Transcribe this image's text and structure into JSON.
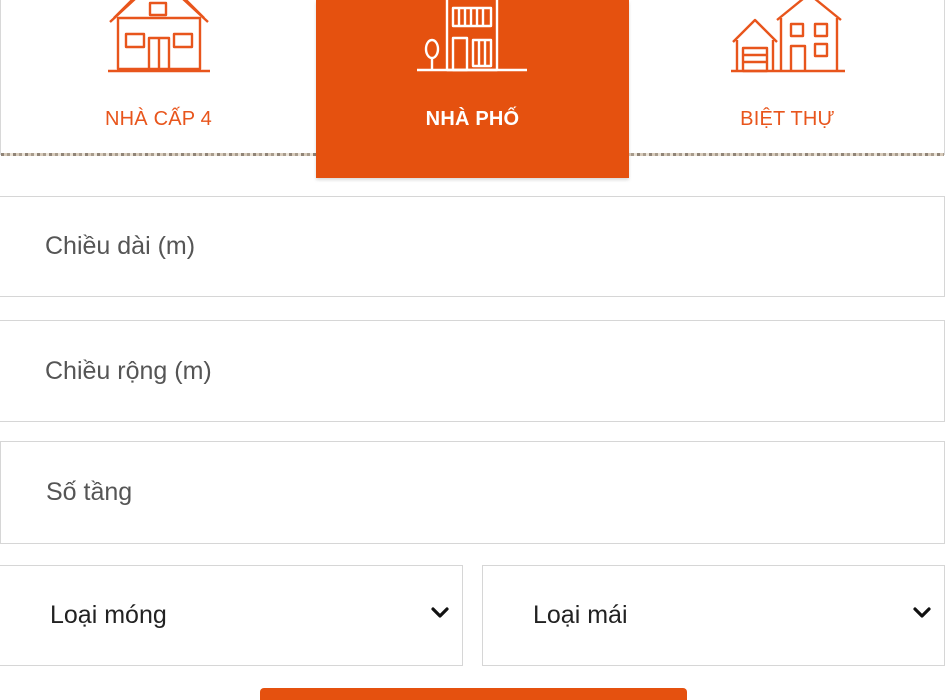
{
  "tabs": [
    {
      "label": "NHÀ CẤP 4",
      "icon": "single-storey-house-icon",
      "active": false
    },
    {
      "label": "NHÀ PHỐ",
      "icon": "townhouse-icon",
      "active": true
    },
    {
      "label": "BIỆT THỰ",
      "icon": "villa-icon",
      "active": false
    }
  ],
  "form": {
    "length_placeholder": "Chiều dài (m)",
    "width_placeholder": "Chiều rộng (m)",
    "floors_placeholder": "Số tầng",
    "foundation_select": {
      "selected": "Loại móng",
      "icon": "chevron-down-icon"
    },
    "roof_select": {
      "selected": "Loại mái",
      "icon": "chevron-down-icon"
    },
    "submit_icon": "submit-button"
  },
  "colors": {
    "accent": "#e5510f",
    "tab_text": "#e8551c",
    "field_border": "#d6d6d6",
    "placeholder": "#555555"
  }
}
